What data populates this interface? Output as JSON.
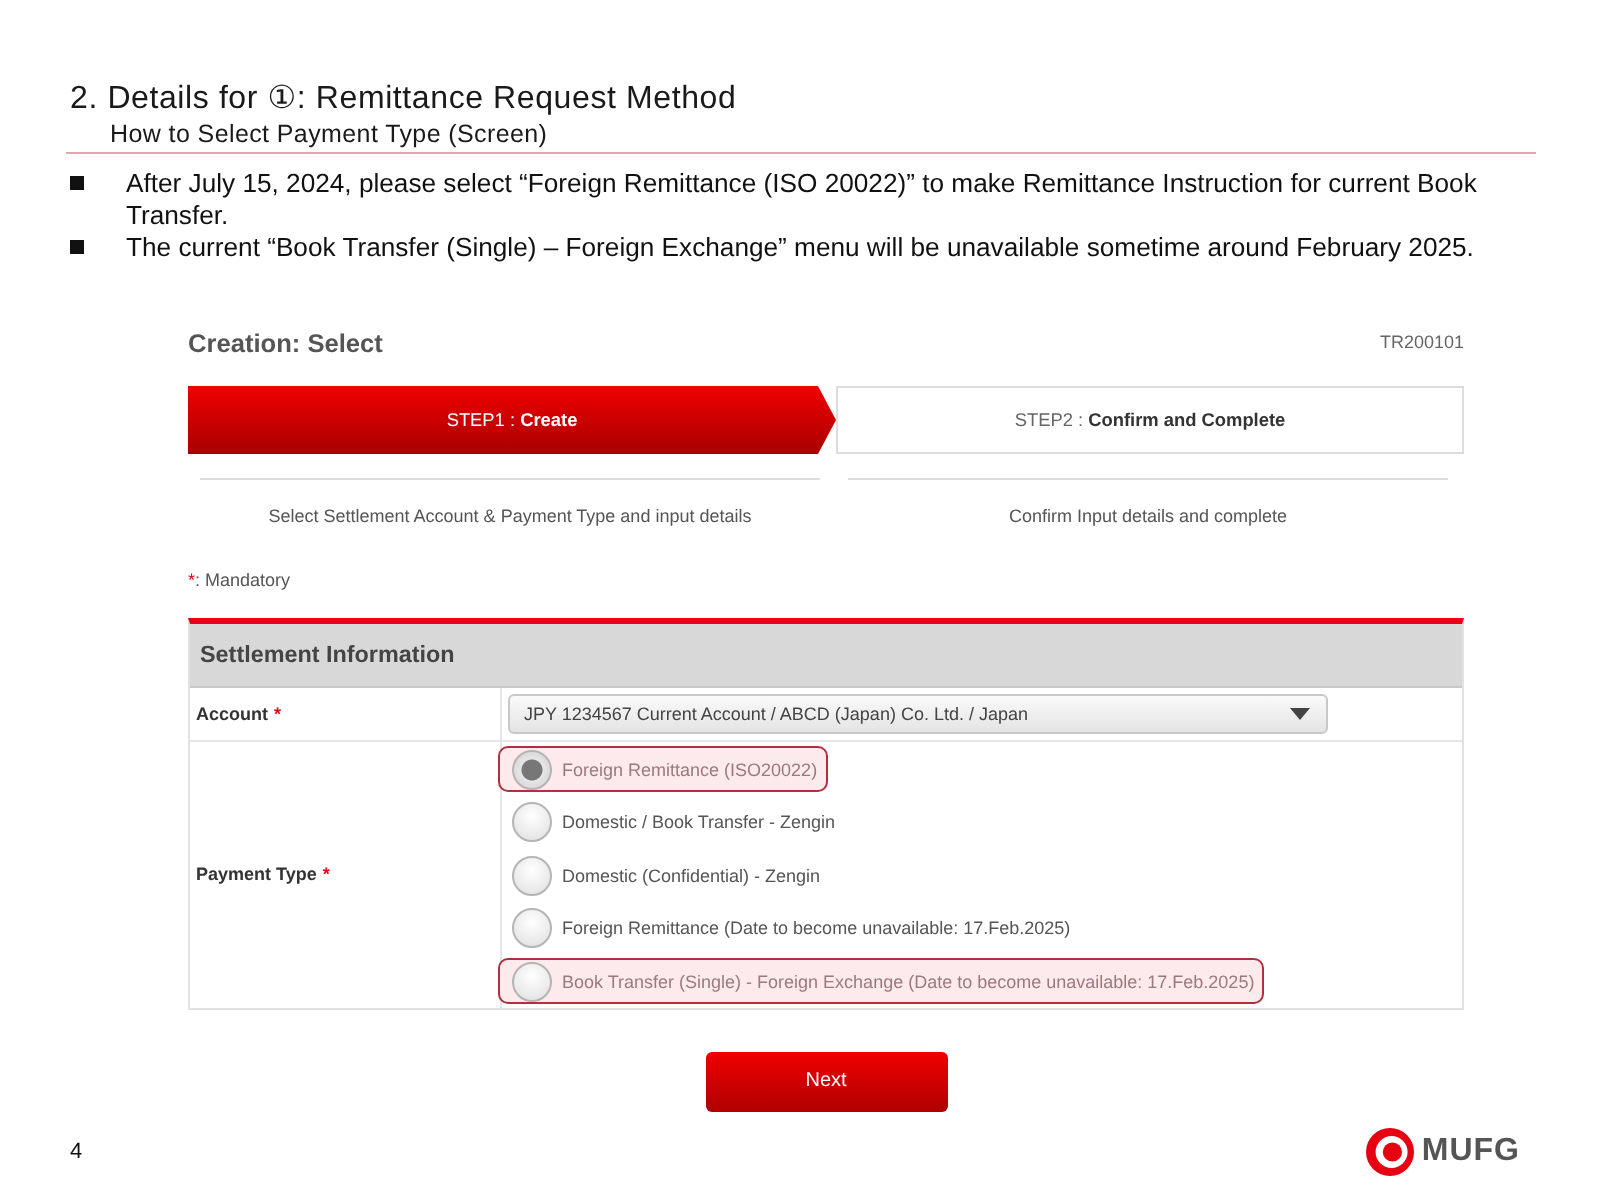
{
  "slide": {
    "title": "2. Details for ①: Remittance Request Method",
    "subtitle": "How to Select Payment Type (Screen)"
  },
  "bullets": [
    "After July 15, 2024, please select “Foreign Remittance (ISO 20022)” to make Remittance Instruction for current Book Transfer.",
    "The current “Book Transfer (Single) – Foreign Exchange” menu will be unavailable sometime around February 2025."
  ],
  "screen": {
    "title": "Creation: Select",
    "screen_id": "TR200101",
    "steps": [
      {
        "label": "STEP1 : **Create**",
        "description": "Select Settlement Account & Payment Type and input details",
        "selected": true
      },
      {
        "label": "STEP2 : **Confirm and Complete**",
        "description": "Confirm Input details and complete",
        "selected": false
      }
    ],
    "mandatory_note": {
      "mark": "*",
      "text": ": Mandatory"
    },
    "settlement": {
      "title": "Settlement Information",
      "account": {
        "label": "Account",
        "required_mark": "*",
        "value": "JPY 1234567 Current Account / ABCD (Japan) Co. Ltd. / Japan"
      },
      "payment_type": {
        "label": "Payment Type",
        "required_mark": "*",
        "options": [
          {
            "label": "Foreign Remittance (ISO20022)",
            "selected": true,
            "highlighted": true
          },
          {
            "label": "Domestic / Book Transfer - Zengin",
            "selected": false,
            "highlighted": false
          },
          {
            "label": "Domestic (Confidential) - Zengin",
            "selected": false,
            "highlighted": false
          },
          {
            "label": "Foreign Remittance (Date to become unavailable: 17.Feb.2025)",
            "selected": false,
            "highlighted": false
          },
          {
            "label": "Book Transfer (Single) - Foreign Exchange (Date to become unavailable: 17.Feb.2025)",
            "selected": false,
            "highlighted": true
          }
        ]
      }
    },
    "next_button": "Next"
  },
  "footer": {
    "page_number": "4",
    "logo_text": "MUFG"
  }
}
